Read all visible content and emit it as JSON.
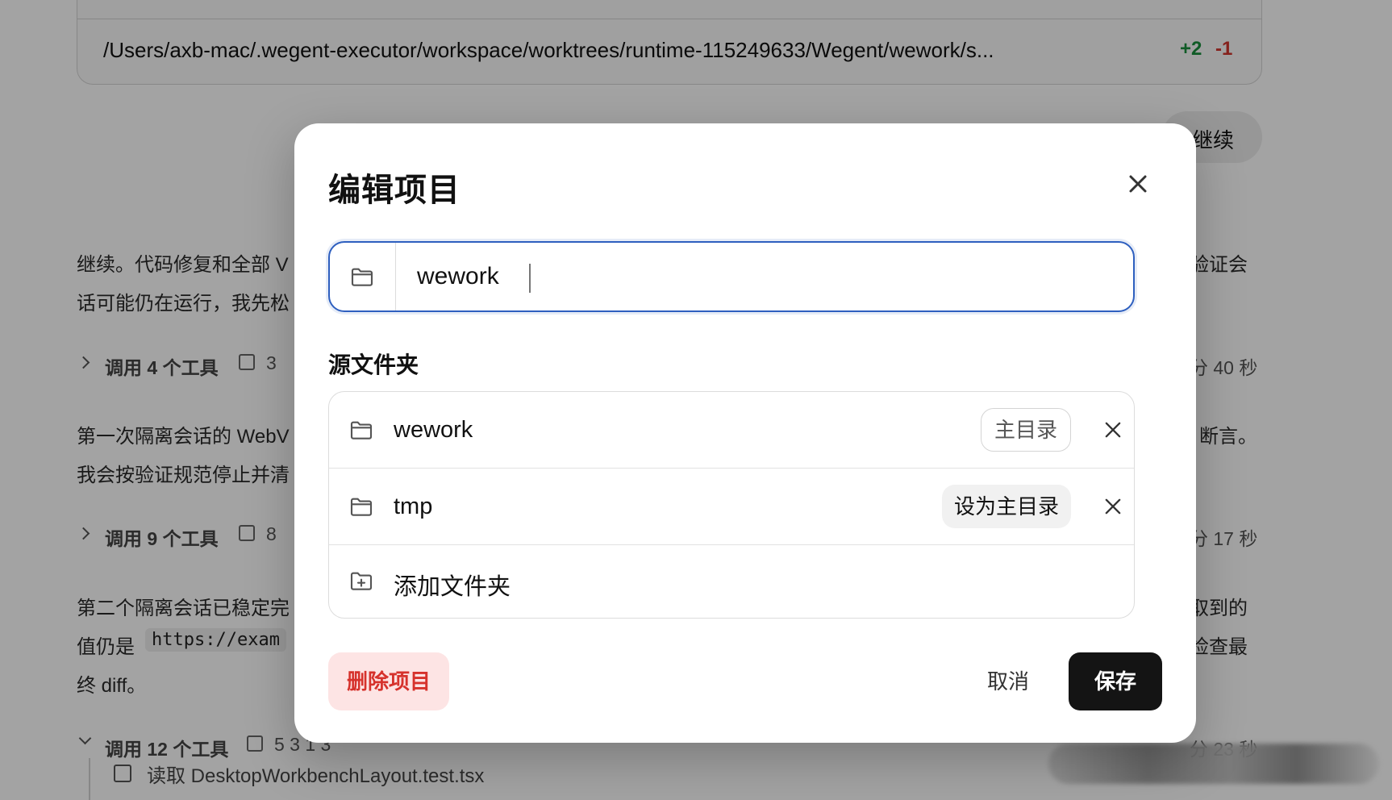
{
  "background": {
    "diff_path": "/Users/axb-mac/.wegent-executor/workspace/worktrees/runtime-115249633/Wegent/wework/s...",
    "diff_added": "+2",
    "diff_removed": "-1",
    "continue_label": "继续",
    "paragraph1_line1": "继续。代码修复和全部 V",
    "paragraph1_line1_end": "验证会",
    "paragraph1_line2": "话可能仍在运行，我先松",
    "tools1_label": "调用 4 个工具",
    "tools1_count": "3",
    "tools1_time": "分 40 秒",
    "paragraph2_line1": "第一次隔离会话的 WebV",
    "paragraph2_line1_end": "断言。",
    "paragraph2_line2": "我会按验证规范停止并清",
    "tools2_label": "调用 9 个工具",
    "tools2_count": "8",
    "tools2_time": "分 17 秒",
    "paragraph3_line1": "第二个隔离会话已稳定完",
    "paragraph3_line1_end": "取到的",
    "paragraph3_line2_prefix": "值仍是",
    "paragraph3_code": "https://exam",
    "paragraph3_line2_end": "检查最",
    "paragraph3_line3": "终 diff。",
    "tools3_label": "调用 12 个工具",
    "tools3_counts": "5   3   1   3",
    "tools3_time": "分 23 秒",
    "subtask_text": "读取 DesktopWorkbenchLayout.test.tsx"
  },
  "modal": {
    "title": "编辑项目",
    "name_value": "wework",
    "section_label": "源文件夹",
    "folders": [
      {
        "name": "wework",
        "badge": "主目录"
      },
      {
        "name": "tmp",
        "action": "设为主目录"
      }
    ],
    "add_folder_label": "添加文件夹",
    "delete_label": "删除项目",
    "cancel_label": "取消",
    "save_label": "保存"
  },
  "icons": {
    "close": "close-icon",
    "folder": "folder-icon",
    "folder_add": "folder-plus-icon",
    "remove": "x-icon"
  },
  "colors": {
    "focus_ring": "#2e5fbf",
    "danger_text": "#d6322c",
    "danger_bg": "#fde4e4",
    "primary_bg": "#141414",
    "diff_add": "#1a8f3c",
    "diff_remove": "#d0342c"
  }
}
